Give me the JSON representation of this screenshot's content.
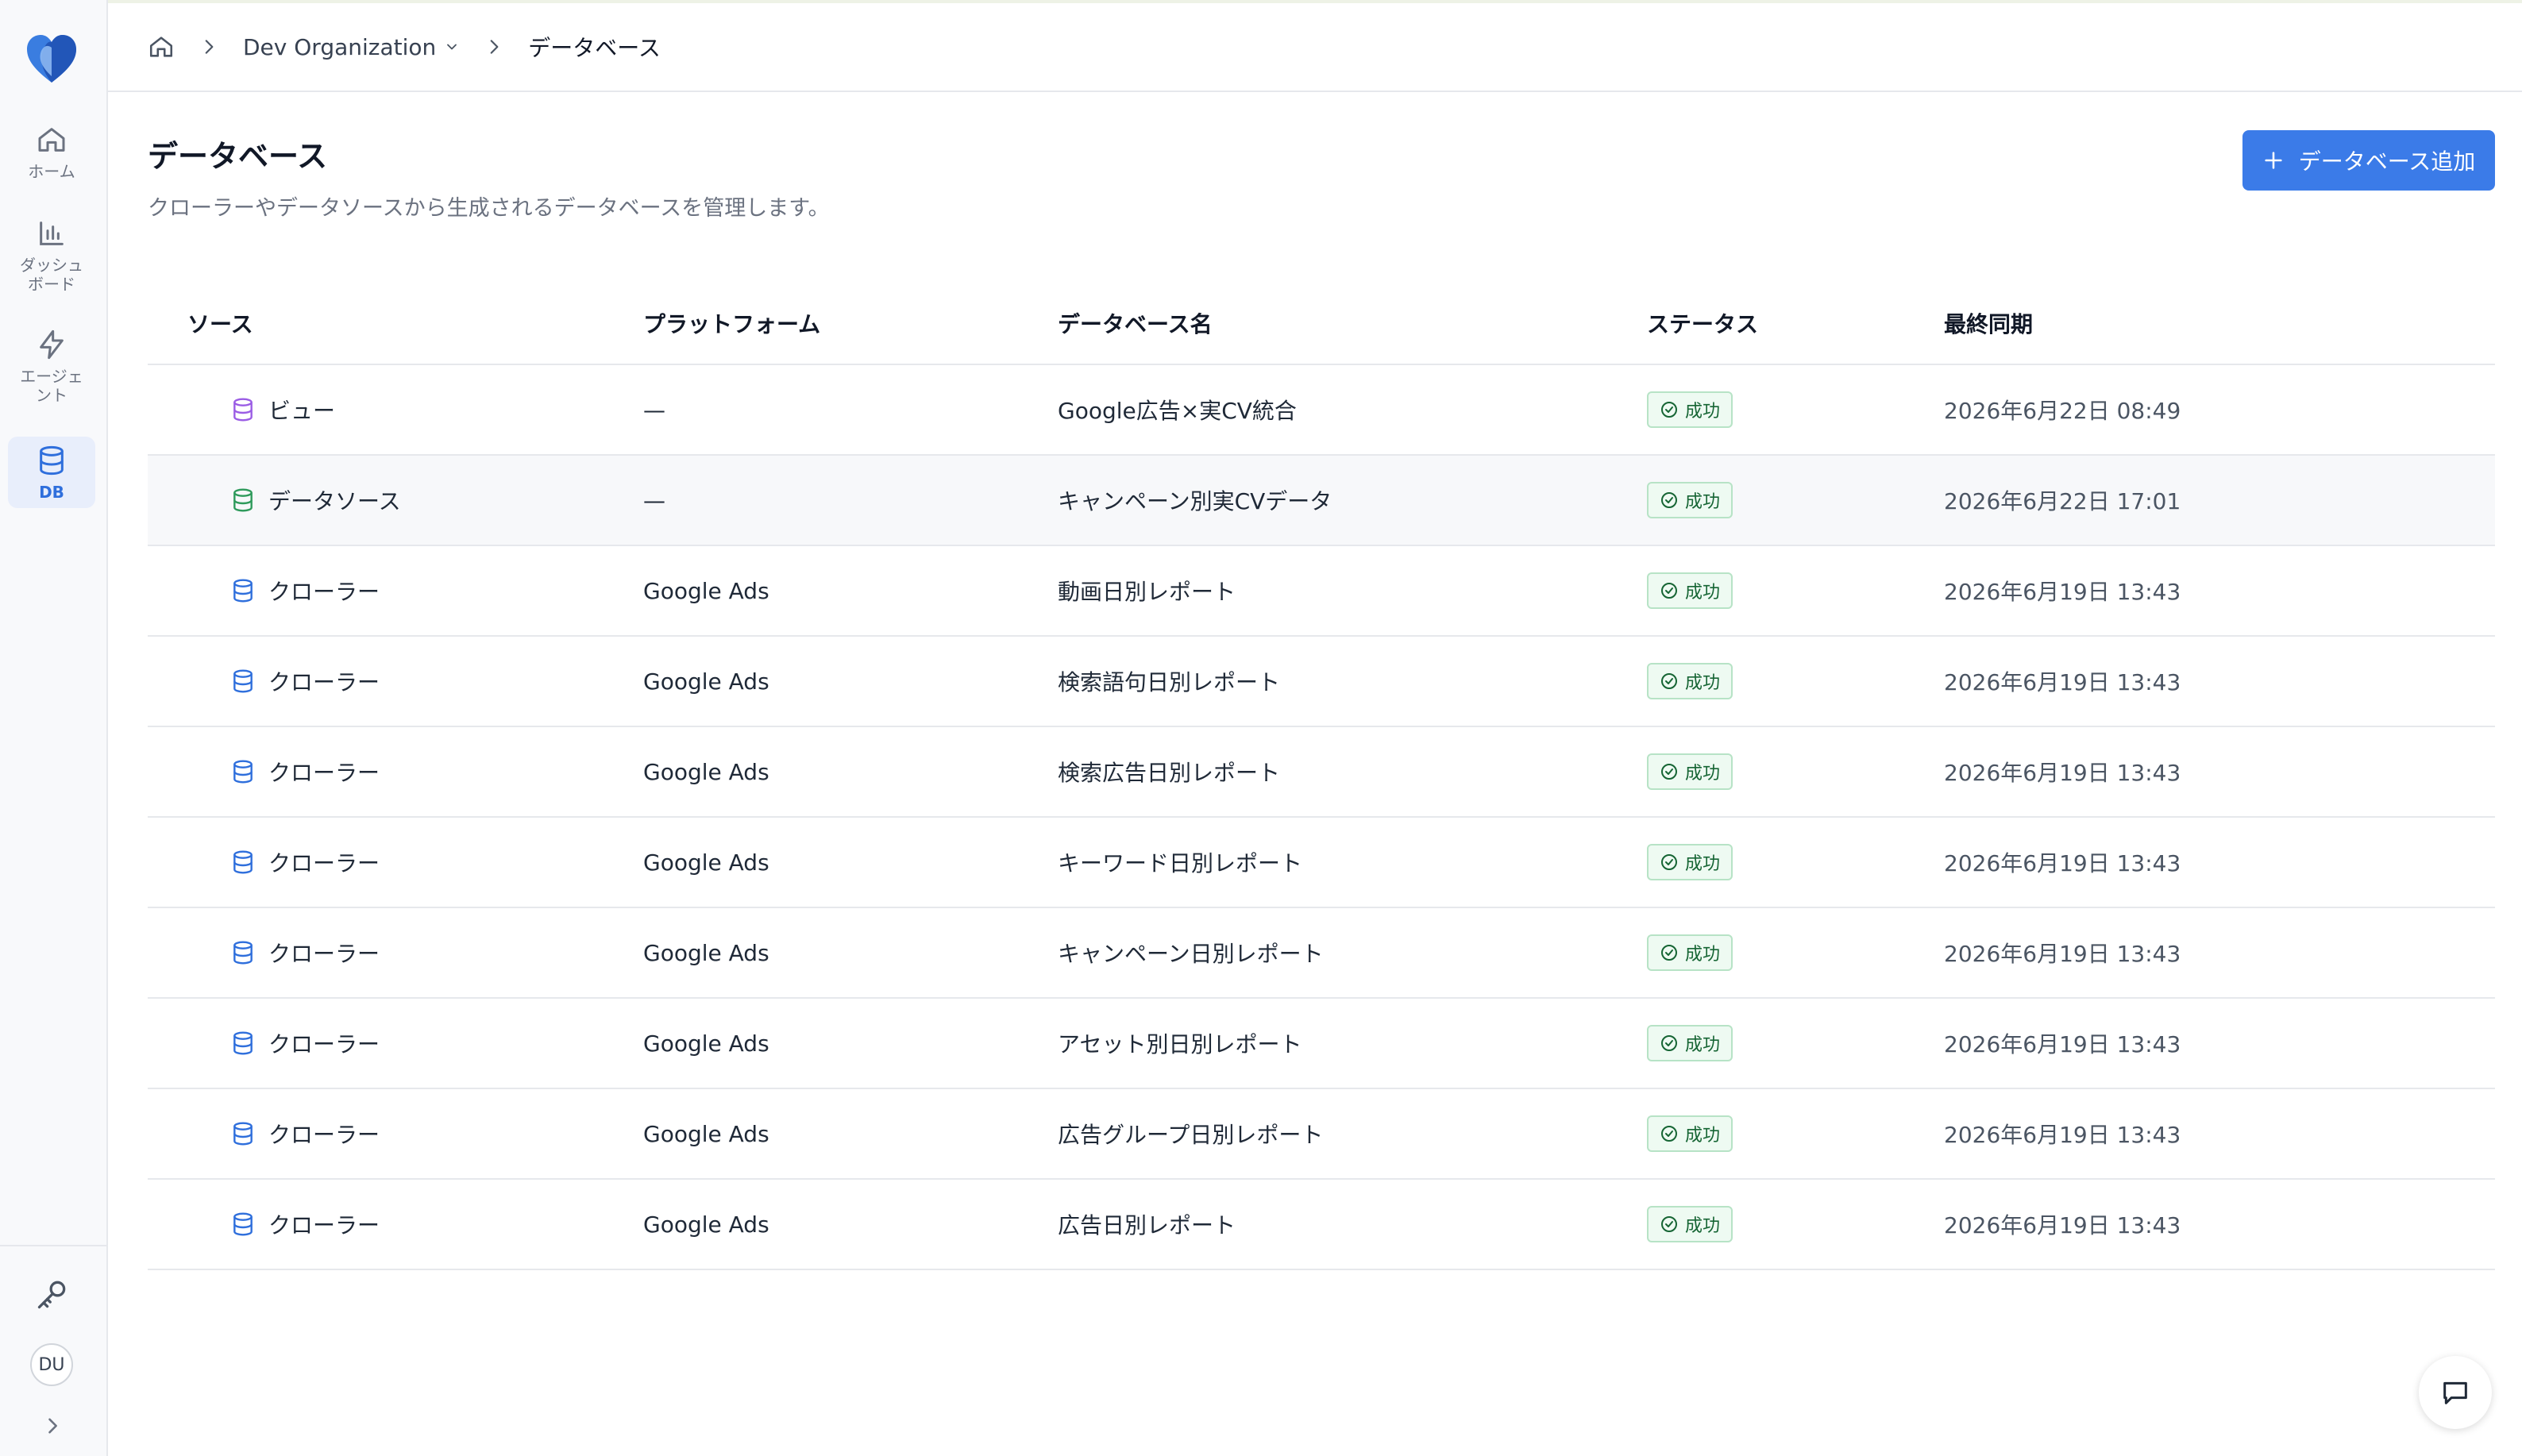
{
  "nav": {
    "items": [
      {
        "label": "ホーム",
        "icon": "home-icon"
      },
      {
        "label": "ダッシュ\nボード",
        "icon": "bar-chart-icon"
      },
      {
        "label": "エージェ\nント",
        "icon": "lightning-icon"
      },
      {
        "label": "DB",
        "icon": "database-icon",
        "active": true
      }
    ],
    "avatar_initials": "DU"
  },
  "breadcrumb": {
    "org": "Dev Organization",
    "current": "データベース"
  },
  "page": {
    "title": "データベース",
    "description": "クローラーやデータソースから生成されるデータベースを管理します。",
    "add_button_label": "データベース追加"
  },
  "table": {
    "headers": [
      "ソース",
      "プラットフォーム",
      "データベース名",
      "ステータス",
      "最終同期"
    ],
    "rows": [
      {
        "source": "ビュー",
        "source_color": "#9b5de5",
        "platform": "—",
        "name": "Google広告×実CV統合",
        "status": "成功",
        "last_sync": "2026年6月22日 08:49"
      },
      {
        "source": "データソース",
        "source_color": "#2e9a5b",
        "platform": "—",
        "name": "キャンペーン別実CVデータ",
        "status": "成功",
        "last_sync": "2026年6月22日 17:01"
      },
      {
        "source": "クローラー",
        "source_color": "#2f6fdc",
        "platform": "Google Ads",
        "name": "動画日別レポート",
        "status": "成功",
        "last_sync": "2026年6月19日 13:43"
      },
      {
        "source": "クローラー",
        "source_color": "#2f6fdc",
        "platform": "Google Ads",
        "name": "検索語句日別レポート",
        "status": "成功",
        "last_sync": "2026年6月19日 13:43"
      },
      {
        "source": "クローラー",
        "source_color": "#2f6fdc",
        "platform": "Google Ads",
        "name": "検索広告日別レポート",
        "status": "成功",
        "last_sync": "2026年6月19日 13:43"
      },
      {
        "source": "クローラー",
        "source_color": "#2f6fdc",
        "platform": "Google Ads",
        "name": "キーワード日別レポート",
        "status": "成功",
        "last_sync": "2026年6月19日 13:43"
      },
      {
        "source": "クローラー",
        "source_color": "#2f6fdc",
        "platform": "Google Ads",
        "name": "キャンペーン日別レポート",
        "status": "成功",
        "last_sync": "2026年6月19日 13:43"
      },
      {
        "source": "クローラー",
        "source_color": "#2f6fdc",
        "platform": "Google Ads",
        "name": "アセット別日別レポート",
        "status": "成功",
        "last_sync": "2026年6月19日 13:43"
      },
      {
        "source": "クローラー",
        "source_color": "#2f6fdc",
        "platform": "Google Ads",
        "name": "広告グループ日別レポート",
        "status": "成功",
        "last_sync": "2026年6月19日 13:43"
      },
      {
        "source": "クローラー",
        "source_color": "#2f6fdc",
        "platform": "Google Ads",
        "name": "広告日別レポート",
        "status": "成功",
        "last_sync": "2026年6月19日 13:43"
      }
    ]
  },
  "colors": {
    "accent": "#3b7be8",
    "success_bg": "#eefaf2",
    "success_text": "#166534"
  }
}
